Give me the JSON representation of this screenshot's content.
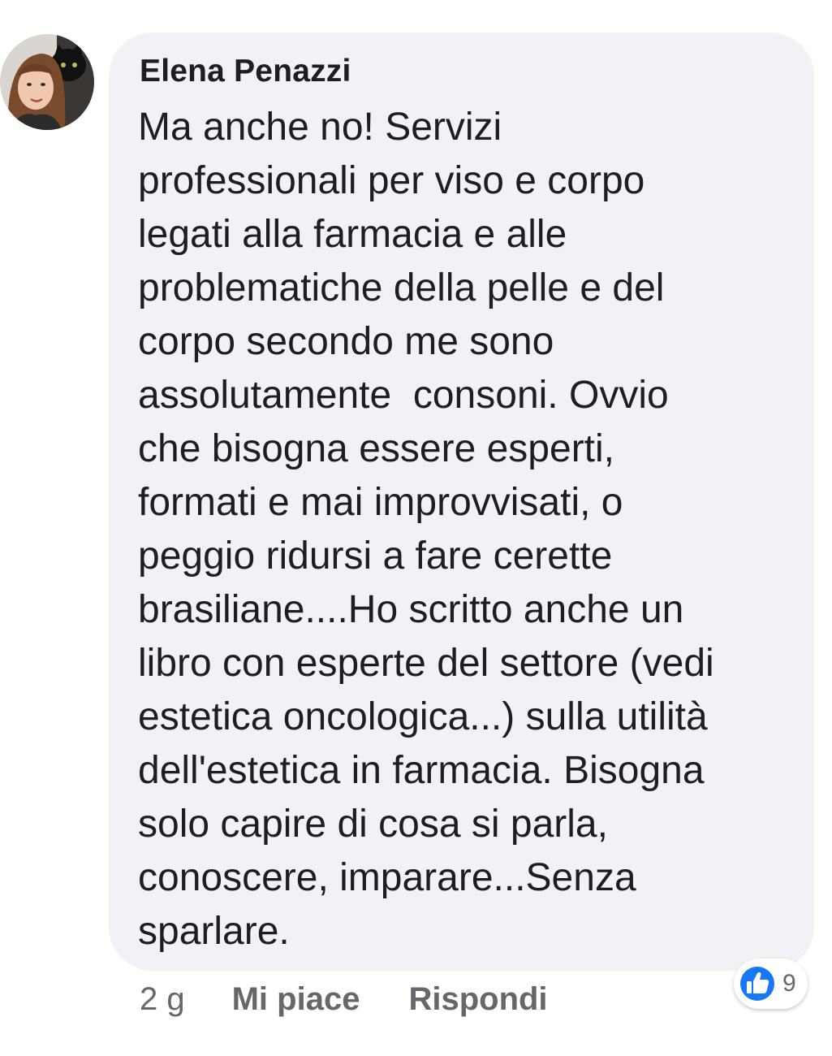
{
  "comment": {
    "author": "Elena Penazzi",
    "text_lines": [
      "Ma anche no! Servizi",
      "professionali per viso e corpo",
      "legati alla farmacia e alle",
      "problematiche della pelle e del",
      "corpo secondo me sono",
      "assolutamente  consoni. Ovvio",
      "che bisogna essere esperti,",
      "formati e mai improvvisati, o",
      "peggio ridursi a fare cerette",
      "brasiliane....Ho scritto anche un",
      "libro con esperte del settore (vedi",
      "estetica oncologica...) sulla utilità",
      "dell'estetica in farmacia. Bisogna",
      "solo capire di cosa si parla,",
      "conoscere, imparare...Senza",
      "sparlare."
    ]
  },
  "actions": {
    "time": "2 g",
    "like_label": "Mi piace",
    "reply_label": "Rispondi"
  },
  "reactions": {
    "icon": "like-icon",
    "count": "9",
    "color": "#1877f2"
  },
  "colors": {
    "bubble": "#f0f2f5",
    "text": "#1c1e21",
    "secondary": "#65676b"
  }
}
